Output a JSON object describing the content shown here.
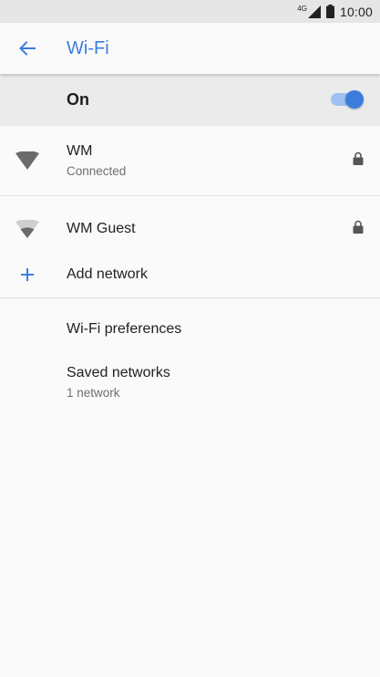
{
  "status_bar": {
    "network_type": "4G",
    "time": "10:00"
  },
  "toolbar": {
    "title": "Wi-Fi",
    "back_icon": "arrow-back-icon"
  },
  "master_switch": {
    "label": "On",
    "enabled": true,
    "accent_color": "#3b7ddd"
  },
  "networks": [
    {
      "name": "WM",
      "status": "Connected",
      "secured": true,
      "signal": "full"
    },
    {
      "name": "WM Guest",
      "status": "",
      "secured": true,
      "signal": "partial"
    }
  ],
  "add_network": {
    "label": "Add network",
    "icon": "plus-icon"
  },
  "preferences": {
    "label": "Wi-Fi preferences"
  },
  "saved_networks": {
    "label": "Saved networks",
    "summary": "1 network"
  }
}
